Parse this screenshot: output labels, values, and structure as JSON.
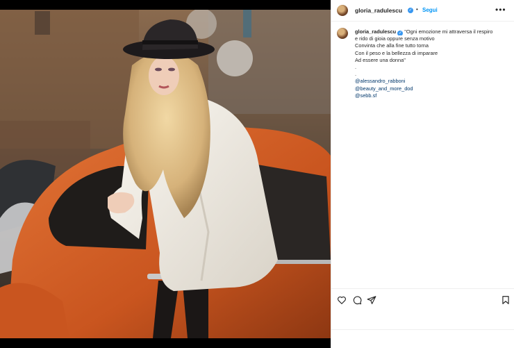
{
  "post": {
    "username": "gloria_radulescu",
    "separator": "•",
    "follow_label": "Segui",
    "more_label": "•••",
    "caption_user": "gloria_radulescu",
    "caption_lines": [
      "\"Ogni emozione mi attraversa il respiro",
      "e rido di gioia oppure senza motivo",
      "Convinta che alla fine tutto torna",
      "Con il peso e la bellezza di imparare",
      "Ad essere una donna\"",
      ".",
      "."
    ],
    "mentions": [
      "@alessandro_rabboni",
      "@beauty_and_more_dod",
      "@sebb.sf"
    ]
  },
  "icons": {
    "like": "heart-icon",
    "comment": "comment-icon",
    "share": "share-icon",
    "save": "bookmark-icon",
    "verified": "verified-badge-icon"
  },
  "colors": {
    "accent": "#0095f6",
    "text": "#262626",
    "verified": "#3897f0",
    "car": "#d9622b"
  }
}
